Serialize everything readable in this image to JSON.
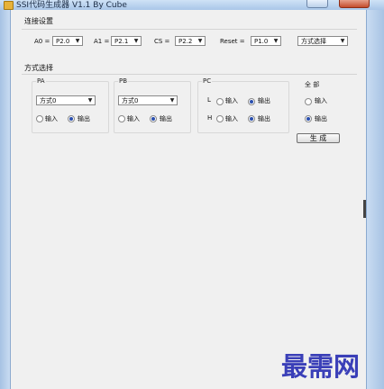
{
  "window": {
    "title": "SSI代码生成器 V1.1 By Cube"
  },
  "connect": {
    "title": "连接设置",
    "a0": {
      "label": "A0 =",
      "value": "P2.0"
    },
    "a1": {
      "label": "A1 =",
      "value": "P2.1"
    },
    "cs": {
      "label": "CS =",
      "value": "P2.2"
    },
    "reset": {
      "label": "Reset =",
      "value": "P1.0"
    },
    "mode_select": "方式选择"
  },
  "mode": {
    "title": "方式选择",
    "pa": {
      "title": "PA",
      "value": "方式0",
      "in_label": "输入",
      "out_label": "输出",
      "selected": "out"
    },
    "pb": {
      "title": "PB",
      "value": "方式0",
      "in_label": "输入",
      "out_label": "输出",
      "selected": "out"
    },
    "pc": {
      "title": "PC",
      "low": {
        "label": "L",
        "in_label": "输入",
        "out_label": "输出",
        "selected": "out"
      },
      "high": {
        "label": "H",
        "in_label": "输入",
        "out_label": "输出",
        "selected": "out"
      }
    },
    "all": {
      "title": "全 部",
      "in_label": "输入",
      "out_label": "输出",
      "selected": "out",
      "generate": "生 成"
    }
  },
  "watermark": "最需网",
  "colors": {
    "radio_dot": "#2a4fae",
    "watermark": "#3a3fb8",
    "title_bar": "#a9c6e8"
  }
}
